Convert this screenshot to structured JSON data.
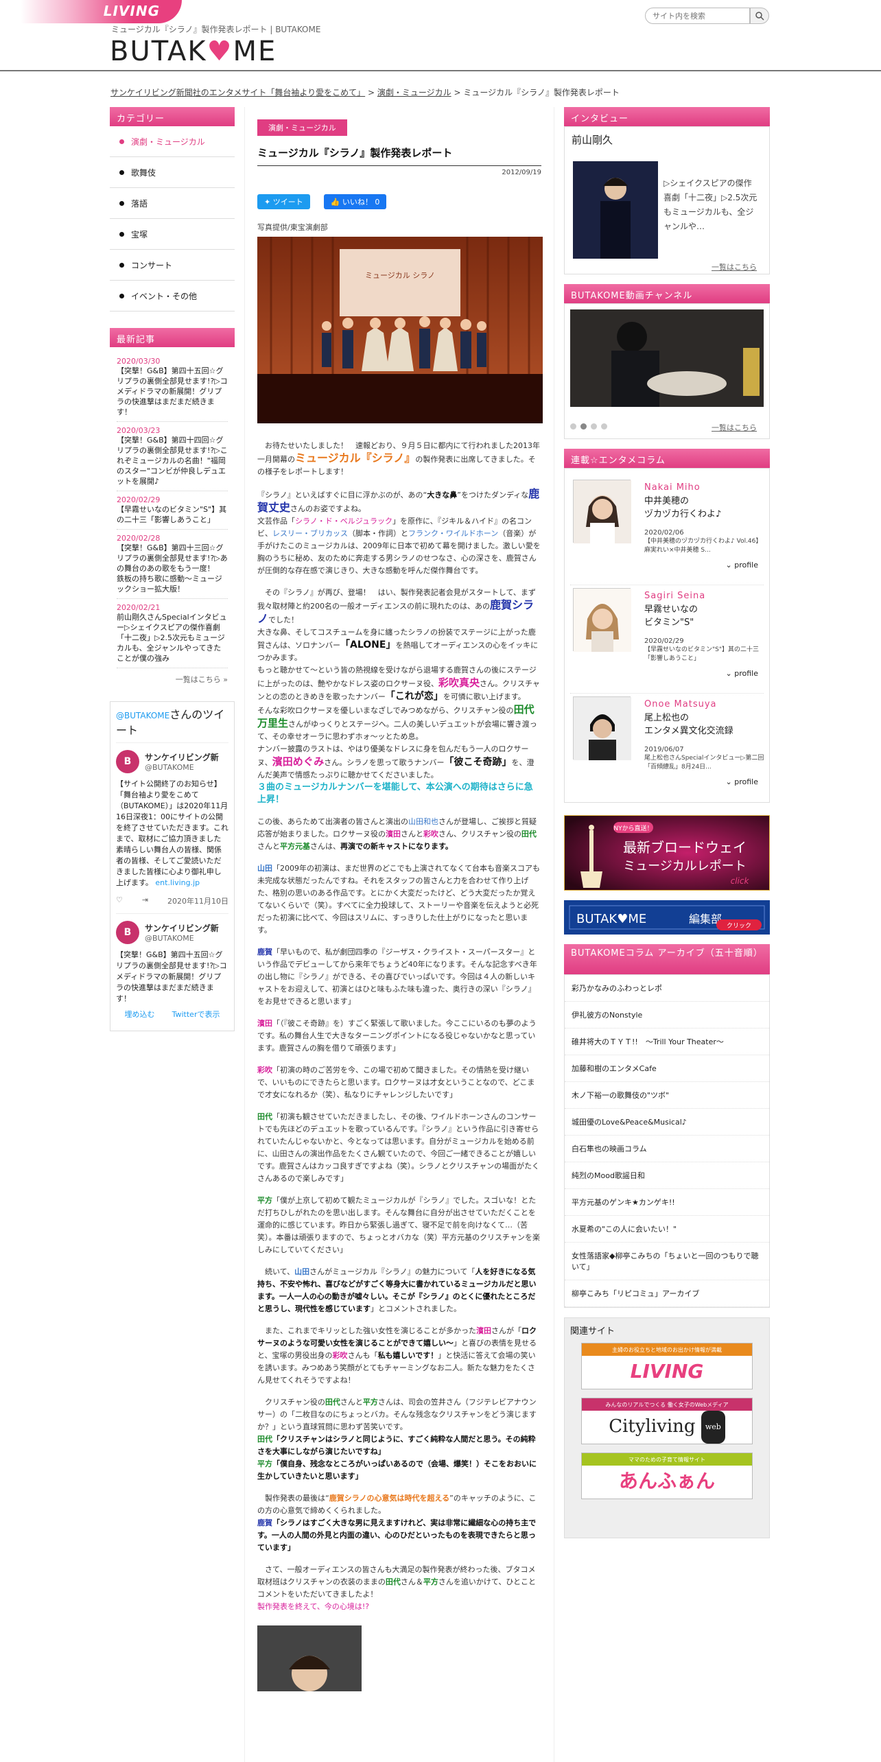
{
  "header": {
    "living_logo": "LIVING",
    "tagline": "ミュージカル『シラノ』製作発表レポート | BUTAKOME",
    "brand_left": "BUTAK",
    "brand_heart": "♥",
    "brand_right": "ME",
    "search_placeholder": "サイト内を検索"
  },
  "breadcrumb": {
    "item1": "サンケイリビング新聞社のエンタメサイト「舞台袖より愛をこめて」",
    "sep1": " > ",
    "item2": "演劇・ミュージカル",
    "sep2": " > ",
    "current": "ミュージカル『シラノ』製作発表レポート"
  },
  "left": {
    "category_head": "カテゴリー",
    "categories": [
      "演劇・ミュージカル",
      "歌舞伎",
      "落語",
      "宝塚",
      "コンサート",
      "イベント・その他"
    ],
    "news_head": "最新記事",
    "news": [
      {
        "date": "2020/03/30",
        "text": "【突撃！G&B】第四十五回☆グリプラの裏側全部見せます!?▷コメディドラマの新展開！グリプラの快進撃はまだまだ続きます！"
      },
      {
        "date": "2020/03/23",
        "text": "【突撃！G&B】第四十四回☆グリプラの裏側全部見せます!?▷これぞミュージカルの名曲！\"福岡のスター\"コンビが仲良しデュエットを展開♪"
      },
      {
        "date": "2020/02/29",
        "text": "【早霧せいなのビタミン\"S\"】其の二十三「影響しあうこと」"
      },
      {
        "date": "2020/02/28",
        "text": "【突撃！G&B】第四十三回☆グリプラの裏側全部見せます!?▷あの舞台のあの歌をもう一度！　鉄板の持ち歌に感動〜ミュージックショー拡大版！"
      },
      {
        "date": "2020/02/21",
        "text": "前山剛久さんSpecialインタビュー▷シェイクスピアの傑作喜劇「十二夜」▷2.5次元もミュージカルも、全ジャンルやってきたことが僕の強み"
      }
    ],
    "news_more": "一覧はこちら »",
    "twitter": {
      "title_handle": "@BUTAKOME",
      "title_text": "さんのツイート",
      "user": "サンケイリビング新",
      "handle": "@BUTAKOME",
      "tweet1": "【サイト公開終了のお知らせ】「舞台袖より愛をこめて（BUTAKOME）」は2020年11月16日深夜1：00にサイトの公開を終了させていただきます。これまで、取材にご協力頂きました素晴らしい舞台人の皆様、関係者の皆様、そしてご愛読いただきました皆様に心より御礼申し上げます。",
      "tweet1_link": "ent.living.jp",
      "tweet1_date": "2020年11月10日",
      "tweet2": "【突撃！G&B】第四十五回☆グリプラの裏側全部見せます!?▷コメディドラマの新展開！グリプラの快進撃はまだまだ続きます！",
      "embed": "埋め込む",
      "view_on": "Twitterで表示"
    }
  },
  "main": {
    "category": "演劇・ミュージカル",
    "title": "ミュージカル『シラノ』製作発表レポート",
    "date": "2012/09/19",
    "tweet_btn": "ツイート",
    "like_btn": "いいね！ 0",
    "credit": "写真提供/東宝演劇部",
    "photo_sign": "ミュージカル シラノ",
    "p1_a": "　お待たせいたしました！　速報どおり、９月５日に都内にて行われました2013年一月開幕の",
    "p1_b": "ミュージカル『シラノ』",
    "p1_c": "の製作発表に出席してきました。その様子をレポートします！",
    "p2_a": "『シラノ』といえばすぐに目に浮かぶのが、あの“",
    "p2_b": "大きな鼻",
    "p2_c": "”をつけたダンディな",
    "p2_d": "鹿賀丈史",
    "p2_e": "さんのお姿ですよね。",
    "p2_f": "文芸作品「",
    "p2_g": "シラノ・ド・ベルジュラック",
    "p2_h": "」を原作に、『ジキル＆ハイド』の名コンビ、",
    "p2_i": "レスリー・ブリカッス",
    "p2_j": "（脚本・作詞）と",
    "p2_k": "フランク・ワイルドホーン",
    "p2_l": "（音楽）が手がけたこのミュージカルは、2009年に日本で初めて幕を開けました。激しい愛を胸のうちに秘め、友のために奔走する男シラノのせつなさ、心の深さを、鹿賀さんが圧倒的な存在感で演じきり、大きな感動を呼んだ傑作舞台です。",
    "p3_a": "　その『シラノ』が再び、登場！　はい、製作発表記者会見がスタートして、まず我々取材陣と約200名の一般オーディエンスの前に現れたのは、あの",
    "p3_b": "鹿賀シラノ",
    "p3_c": "でした！",
    "p3_d": "大きな鼻、そしてコスチュームを身に纏ったシラノの扮装でステージに上がった鹿賀さんは、ソロナンバー",
    "p3_e": "「ALONE」",
    "p3_f": "を熱唱してオーディエンスの心をイッキにつかみます。",
    "p3_g": "もっと聴かせて～という皆の熱視線を受けながら退場する鹿賀さんの後にステージに上がったのは、艶やかなドレス姿のロクサーヌ役、",
    "p3_h": "彩吹真央",
    "p3_i": "さん。クリスチャンとの恋のときめきを歌ったナンバー",
    "p3_j": "「これが恋」",
    "p3_k": "を可憐に歌い上げます。",
    "p3_l": "そんな彩吹ロクサーヌを優しいまなざしでみつめながら、クリスチャン役の",
    "p3_m": "田代万里生",
    "p3_n": "さんがゆっくりとステージへ。二人の美しいデュエットが会場に響き渡って、その幸せオーラに思わずホォ～ッとため息。",
    "p3_o": "ナンバー披露のラストは、やはり優美なドレスに身を包んだもう一人のロクサーヌ、",
    "p3_p": "濱田めぐみ",
    "p3_q": "さん。シラノを思って歌うナンバー",
    "p3_r": "「彼こそ奇跡」",
    "p3_s": "を、澄んだ美声で情感たっぷりに聴かせてくださいました。",
    "p3_t": "３曲のミュージカルナンバーを堪能して、本公演への期待はさらに急上昇！",
    "p4_a": "この後、あらためて出演者の皆さんと演出の",
    "p4_b": "山田和也",
    "p4_c": "さんが登場し、ご挨拶と質疑応答が始まりました。ロクサーヌ役の",
    "p4_d": "濱田",
    "p4_e": "さんと",
    "p4_f": "彩吹",
    "p4_g": "さん、クリスチャン役の",
    "p4_h": "田代",
    "p4_i": "さんと",
    "p4_j": "平方元基",
    "p4_k": "さんは、",
    "p4_l": "再演での新キャストになります。",
    "q1_spk": "山田",
    "q1": "「2009年の初演は、まだ世界のどこでも上演されてなくて台本も音楽スコアも未完成な状態だったんですね。それをスタッフの皆さんと力を合わせて作り上げた、格別の思いのある作品です。とにかく大変だったけど、どう大変だったか覚えてないくらいで（笑）。すべてに全力投球して、ストーリーや音楽を伝えようと必死だった初演に比べて、今回はスリムに、すっきりした仕上がりになったと思います。",
    "q2_spk": "鹿賀",
    "q2": "「早いもので、私が劇団四季の『ジーザス・クライスト・スーパースター』という作品でデビューしてから来年でちょうど40年になります。そんな記念すべき年の出し物に『シラノ』ができる、その喜びでいっぱいです。今回は４人の新しいキャストをお迎えして、初演とはひと味もふた味も違った、奥行きの深い『シラノ』をお見せできると思います」",
    "q3_spk": "濱田",
    "q3": "「（『彼こそ奇跡』を）すごく緊張して歌いました。今ここにいるのも夢のようです。私の舞台人生で大きなターニングポイントになる役じゃないかなと思っています。鹿賀さんの胸を借りて頑張ります」",
    "q4_spk": "彩吹",
    "q4": "「初演の時のご苦労を今、この場で初めて聞きました。その情熱を受け継いで、いいものにできたらと思います。ロクサーヌは才女ということなので、どこまで才女になれるか（笑）、私なりにチャレンジしたいです」",
    "q5_spk": "田代",
    "q5": "「初演も観させていただきましたし、その後、ワイルドホーンさんのコンサートでも先ほどのデュエットを歌っているんです。『シラノ』という作品に引き寄せられていたんじゃないかと、今となっては思います。自分がミュージカルを始める前に、山田さんの演出作品をたくさん観ていたので、今回ご一緒できることが嬉しいです。鹿賀さんはカッコ良すぎですよね（笑）。シラノとクリスチャンの場面がたくさんあるので楽しみです」",
    "q6_spk": "平方",
    "q6": "「僕が上京して初めて観たミュージカルが『シラノ』でした。スゴいな！とただ打ちひしがれたのを思い出します。そんな舞台に自分が出させていただくことを運命的に感じています。昨日から緊張し過ぎて、寝不足で前を向けなくて…（苦笑）。本番は頑張りますので、ちょっとオバカな（笑）平方元基のクリスチャンを楽しみにしていてください」",
    "p5_a": "　続いて、",
    "p5_b": "山田",
    "p5_c": "さんがミュージカル『シラノ』の魅力について「",
    "p5_d": "人を好きになる気持ち、不安や怖れ、喜びなどがすごく等身大に書かれているミュージカルだと思います。一人一人の心の動きが嘘々しい。そこが『シラノ』のとくに優れたところだと思うし、現代性を感じています",
    "p5_e": "」とコメントされました。",
    "p6_a": "　また、これまでキリッとした強い女性を演じることが多かった",
    "p6_b": "濱田",
    "p6_c": "さんが「",
    "p6_d": "ロクサーヌのような可愛い女性を演じることができて嬉しい～",
    "p6_e": "」と喜びの表情を見せると、宝塚の男役出身の",
    "p6_f": "彩吹",
    "p6_g": "さんも「",
    "p6_h": "私も嬉しいです！",
    "p6_i": "」と快活に答えて会場の笑いを誘います。みつめあう笑顔がとてもチャーミングなお二人。新たな魅力をたくさん見せてくれそうですよね！",
    "p7_a": "　クリスチャン役の",
    "p7_b": "田代",
    "p7_c": "さんと",
    "p7_d": "平方",
    "p7_e": "さんは、司会の笠井さん（フジテレビアナウンサー）の「二枚目なのにちょっとバカ。そんな残念なクリスチャンをどう演じますか？」という直球質問に思わず苦笑いです。",
    "p7_f": "田代",
    "p7_g": "「クリスチャンはシラノと同じように、すごく純粋な人間だと思う。その純粋さを大事にしながら演じたいですね」",
    "p7_h": "平方",
    "p7_i": "「僕自身、残念なところがいっぱいあるので（会場、爆笑！）そこをおおいに生かしていきたいと思います」",
    "p8_a": "　製作発表の最後は“",
    "p8_b": "鹿賀シラノの心意気は時代を超える",
    "p8_c": "”のキャッチのように、この方の心意気で締めくくられました。",
    "p8_d": "鹿賀",
    "p8_e": "「シラノはすごく大きな男に見えますけれど、実は非常に繊細な心の持ち主です。一人の人間の外見と内面の違い、心のひだといったものを表現できたらと思っています」",
    "p9_a": "　さて、一般オーディエンスの皆さんも大満足の製作発表が終わった後、ブタコメ取材班はクリスチャンの衣装のままの",
    "p9_b": "田代",
    "p9_c": "さん＆",
    "p9_d": "平方",
    "p9_e": "さんを追いかけて、ひとことコメントをいただいてきましたよ！",
    "p9_f": "製作発表を終えて、今の心境は!?"
  },
  "right": {
    "interview_head": "インタビュー",
    "interview_name": "前山剛久",
    "interview_text": "▷シェイクスピアの傑作喜劇「十二夜」▷2.5次元もミュージカルも、全ジャンルや…",
    "interview_more": "一覧はこちら",
    "video_head": "BUTAKOME動画チャンネル",
    "video_more": "一覧はこちら",
    "column_head": "連載☆エンタメコラム",
    "columns": [
      {
        "name": "Nakai Miho",
        "title": "中井美穂の\nヅカヅカ行くわよ♪",
        "date": "2020/02/06",
        "desc": "【中井美穂のヅカヅカ行くわよ♪ Vol.46】麻実れい×中井美穂 S..."
      },
      {
        "name": "Sagiri Seina",
        "title": "早霧せいなの\nビタミン\"S\"",
        "date": "2020/02/29",
        "desc": "【早霧せいなのビタミン\"S\"】其の二十三「影響しあうこと」"
      },
      {
        "name": "Onoe Matsuya",
        "title": "尾上松也の\nエンタメ異文化交流録",
        "date": "2019/06/07",
        "desc": "尾上松也さんSpecialインタビュー▷第二回「百傾繚乱」8月24日..."
      }
    ],
    "profile": "profile",
    "broadway_small": "NYから直送！",
    "broadway_l1": "最新ブロードウェイ",
    "broadway_l2": "ミュージカルレポート",
    "broadway_click": "click",
    "edit_brand": "BUTAK♥ME",
    "edit_label": "編集部",
    "edit_click": "クリック",
    "archive_head": "BUTAKOMEコラム アーカイブ（五十音順）",
    "archive": [
      "彩乃かなみのふわっとレポ",
      "伊礼彼方のNonstyle",
      "碓井将大のＴＹＴ!!　～Trill Your Theater～",
      "加藤和樹のエンタメCafe",
      "木ノ下裕一の歌舞伎の\"ツボ\"",
      "城田優のLove&Peace&Musical♪",
      "白石隼也の映画コラム",
      "純烈のMood歌謡日和",
      "平方元基のゲンキ★カンゲキ!!",
      "水夏希の\"この人に会いたい！\"",
      "女性落語家◆柳亭こみちの「ちょいと一回のつもりで聴いて」",
      "柳亭こみち「リピコミュ」アーカイブ"
    ],
    "related_head": "関連サイト",
    "rel1_cap": "主婦のお役立ちと地域のお出かけ情報が満載",
    "rel1_logo": "LIVING",
    "rel2_cap": "みんなのリアルでつくる 働く女子のWebメディア",
    "rel2_logo": "Cityliving",
    "rel2_badge": "web",
    "rel3_cap": "ママのための子育て情報サイト",
    "rel3_logo": "あんふぁん"
  },
  "colors": {
    "accent_pink": "#e03d82",
    "orange": "#e8781d",
    "green": "#1c8b2b",
    "blue": "#2233aa",
    "magenta": "#d8219b",
    "cyan": "#1fb3c9"
  }
}
